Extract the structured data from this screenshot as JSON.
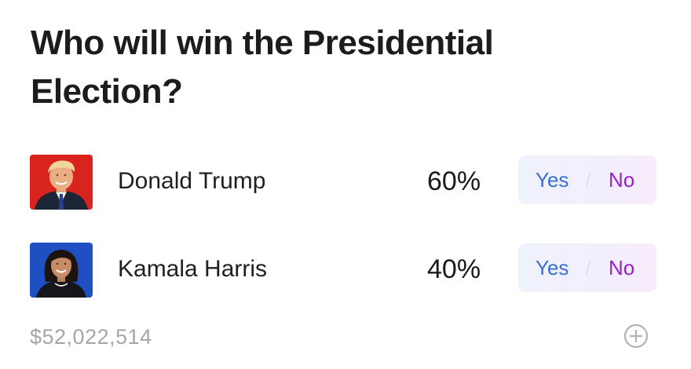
{
  "market": {
    "question": "Who will win the Presidential Election?",
    "volume": "$52,022,514",
    "add_icon": "plus-circle-icon",
    "outcomes": [
      {
        "name": "Donald Trump",
        "percent": "60%",
        "yes_label": "Yes",
        "separator": "/",
        "no_label": "No",
        "avatar_bg": "#d9231d"
      },
      {
        "name": "Kamala Harris",
        "percent": "40%",
        "yes_label": "Yes",
        "separator": "/",
        "no_label": "No",
        "avatar_bg": "#1f4fc0"
      }
    ]
  },
  "colors": {
    "yes": "#3b6fd6",
    "no": "#9a1fd1",
    "muted": "#a6a6a6"
  }
}
